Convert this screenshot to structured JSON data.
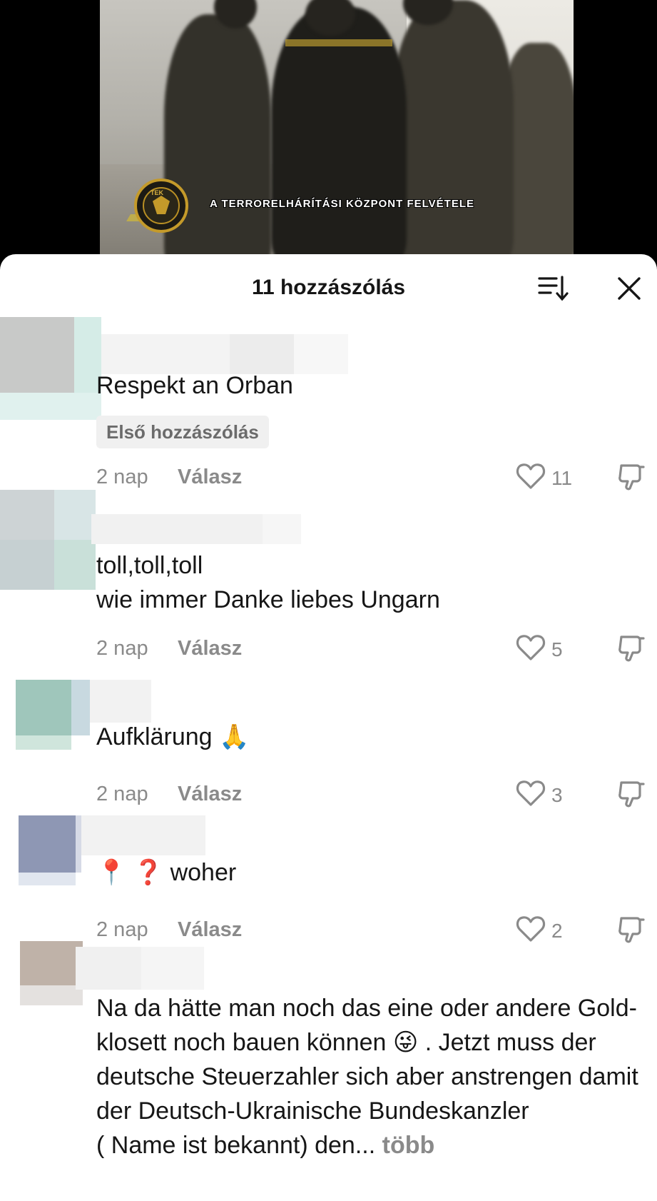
{
  "video": {
    "caption": "A TERRORELHÁRÍTÁSI KÖZPONT FELVÉTELE",
    "logo_text": "TEK"
  },
  "sheet": {
    "title": "11 hozzászólás",
    "sort_icon": "sort-icon",
    "close_icon": "close-icon"
  },
  "comments": [
    {
      "text": "Respekt an Orban",
      "badge": "Első hozzászólás",
      "time": "2 nap",
      "reply": "Válasz",
      "likes": "11"
    },
    {
      "text": "toll,toll,toll\nwie immer Danke liebes Ungarn",
      "time": "2 nap",
      "reply": "Válasz",
      "likes": "5"
    },
    {
      "text": "Aufklärung 🙏",
      "time": "2 nap",
      "reply": "Válasz",
      "likes": "3"
    },
    {
      "text": "📍 ❓ woher",
      "time": "2 nap",
      "reply": "Válasz",
      "likes": "2"
    },
    {
      "text": "Na da hätte man noch das eine oder andere Gold-klosett noch bauen können 😜 . Jetzt muss der deutsche Steuerzahler sich aber anstrengen damit der Deutsch-Ukrainische Bundeskanzler\n( Name ist bekannt) den...",
      "more": "több"
    }
  ],
  "colors": {
    "text": "#161616",
    "muted": "#8a8a8a",
    "badge_bg": "#f0f0f0"
  }
}
